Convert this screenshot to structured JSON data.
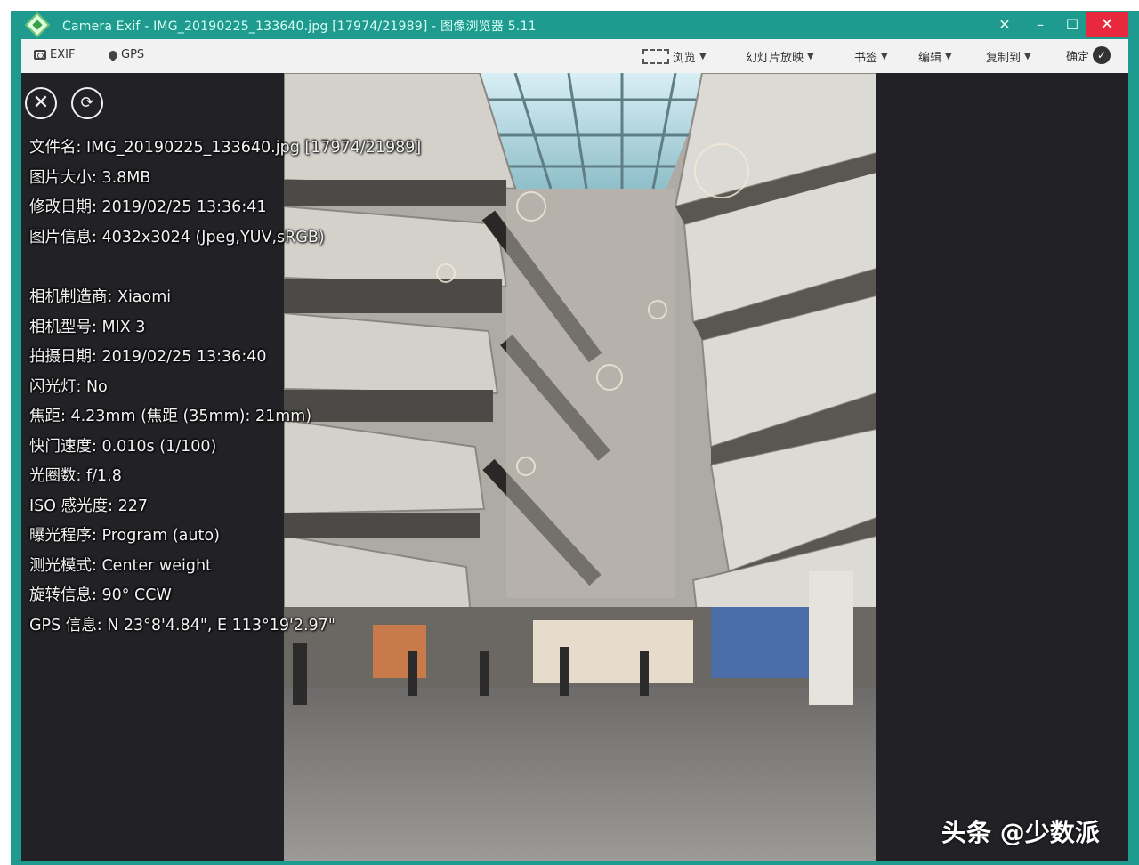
{
  "window": {
    "title": "Camera Exif - IMG_20190225_133640.jpg [17974/21989] - 图像浏览器 5.11"
  },
  "toolbar": {
    "exif_label": "EXIF",
    "gps_label": "GPS",
    "menus": [
      "浏览",
      "幻灯片放映",
      "书签",
      "编辑",
      "复制到",
      "确定"
    ]
  },
  "exif": {
    "lines": [
      "文件名: IMG_20190225_133640.jpg [17974/21989]",
      "图片大小: 3.8MB",
      "修改日期: 2019/02/25 13:36:41",
      "图片信息: 4032x3024 (Jpeg,YUV,sRGB)",
      "相机制造商: Xiaomi",
      "相机型号: MIX 3",
      "拍摄日期: 2019/02/25 13:36:40",
      "闪光灯: No",
      "焦距: 4.23mm (焦距 (35mm): 21mm)",
      "快门速度: 0.010s (1/100)",
      "光圈数: f/1.8",
      "ISO 感光度: 227",
      "曝光程序: Program (auto)",
      "测光模式: Center weight",
      "旋转信息: 90° CCW",
      "GPS 信息: N 23°8'4.84\", E 113°19'2.97\""
    ]
  },
  "watermark": {
    "text": "头条 @少数派"
  },
  "colors": {
    "frame": "#1e9a8e",
    "viewer_bg": "#222226",
    "toolbar_bg": "#f2f2f2",
    "close_button": "#e8283c"
  }
}
